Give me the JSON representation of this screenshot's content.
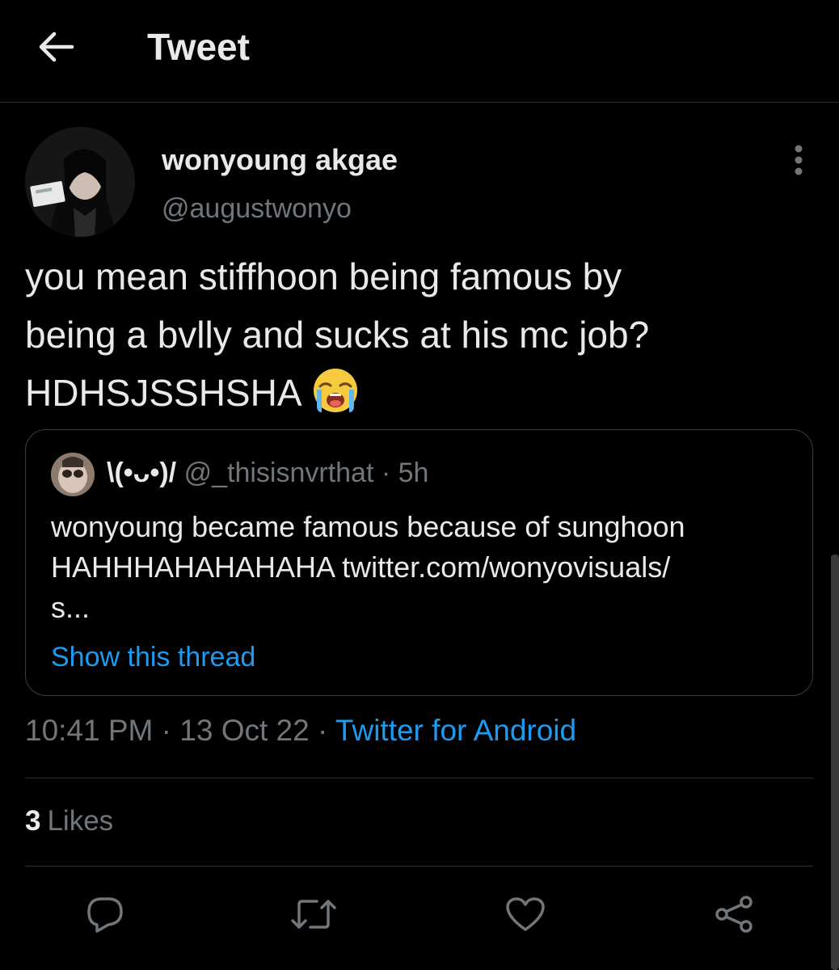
{
  "header": {
    "title": "Tweet",
    "back_icon": "arrow-left-icon"
  },
  "tweet": {
    "display_name": "wonyoung akgae",
    "handle": "@augustwonyo",
    "text": "you mean stiffhoon being famous by\nbeing a bvlly and sucks at his mc job?\nHDHSJSSHSHA",
    "emoji": "loudly-crying-face-emoji",
    "time": "10:41 PM",
    "sep1": " · ",
    "date": "13 Oct 22",
    "sep2": " · ",
    "source": "Twitter for Android",
    "likes_count": "3",
    "likes_label": "Likes"
  },
  "quote": {
    "name": "\\(•ᴗ•)/",
    "handle": "@_thisisnvrthat",
    "dot": " · ",
    "time": "5h",
    "text": "wonyoung became famous because of sunghoon\nHAHHHAHAHAHAHA twitter.com/wonyovisuals/\ns...",
    "show_thread": "Show this thread"
  },
  "actions": [
    "reply-icon",
    "retweet-icon",
    "like-icon",
    "share-icon"
  ],
  "colors": {
    "background": "#000000",
    "text": "#e7e9ea",
    "secondary": "#71767b",
    "accent": "#1d9bf0",
    "border": "#2f3336"
  }
}
